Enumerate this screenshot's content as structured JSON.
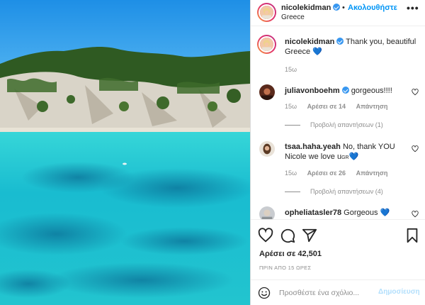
{
  "post": {
    "username": "nicolekidman",
    "location": "Greece",
    "separator": "•",
    "follow_label": "Ακολουθήστε",
    "more_label": "•••"
  },
  "caption": {
    "username": "nicolekidman",
    "text": "Thank you, beautiful Greece 💙",
    "time": "15ω"
  },
  "comments": [
    {
      "username": "juliavonboehm",
      "verified": true,
      "text": "gorgeous!!!!",
      "time": "15ω",
      "likes": "Αρέσει σε 14",
      "reply": "Απάντηση",
      "view_replies": "Προβολή απαντήσεων (1)"
    },
    {
      "username": "tsaa.haha.yeah",
      "verified": false,
      "text": "No, thank YOU Nicole we love u",
      "small_text": "GR",
      "emoji": "💙",
      "time": "15ω",
      "likes": "Αρέσει σε 26",
      "reply": "Απάντηση",
      "view_replies": "Προβολή απαντήσεων (4)"
    },
    {
      "username": "opheliatasler78",
      "verified": false,
      "text": "Gorgeous 💙"
    }
  ],
  "actions": {
    "likes_text": "Αρέσει σε 42,501",
    "time_ago": "ΠΡΙΝ ΑΠΟ 15 ΩΡΕΣ"
  },
  "comment_box": {
    "placeholder": "Προσθέστε ένα σχόλιο...",
    "post_label": "Δημοσίευση"
  },
  "colors": {
    "accent": "#0095f6",
    "verified": "#3897f0",
    "sea": "#1fc8d4",
    "sky": "#2e9be8"
  },
  "icons": [
    "verified-badge-icon",
    "more-options-icon",
    "heart-icon",
    "comment-icon",
    "share-icon",
    "save-icon",
    "emoji-icon"
  ]
}
